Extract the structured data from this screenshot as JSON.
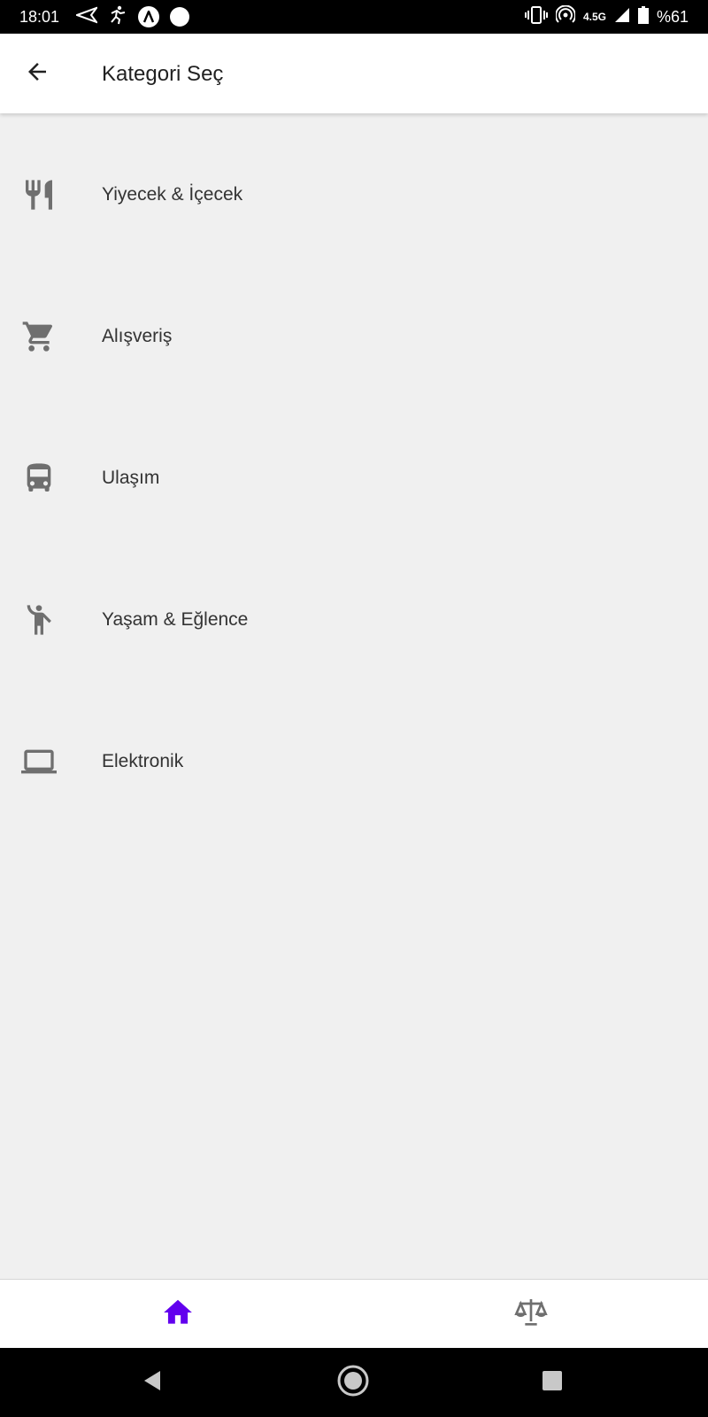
{
  "status_bar": {
    "time": "18:01",
    "network": "4.5G",
    "battery": "%61"
  },
  "app_bar": {
    "title": "Kategori Seç",
    "back_icon": "arrow-back-icon"
  },
  "categories": [
    {
      "label": "Yiyecek & İçecek",
      "icon": "restaurant-icon"
    },
    {
      "label": "Alışveriş",
      "icon": "shopping-cart-icon"
    },
    {
      "label": "Ulaşım",
      "icon": "bus-icon"
    },
    {
      "label": "Yaşam & Eğlence",
      "icon": "person-arms-up-icon"
    },
    {
      "label": "Elektronik",
      "icon": "laptop-icon"
    }
  ],
  "bottom_nav": {
    "items": [
      {
        "icon": "home-icon",
        "active": true
      },
      {
        "icon": "scale-icon",
        "active": false
      }
    ]
  },
  "colors": {
    "accent": "#6200ee",
    "icon_gray": "#6f6f6f",
    "background": "#f0f0f0"
  }
}
